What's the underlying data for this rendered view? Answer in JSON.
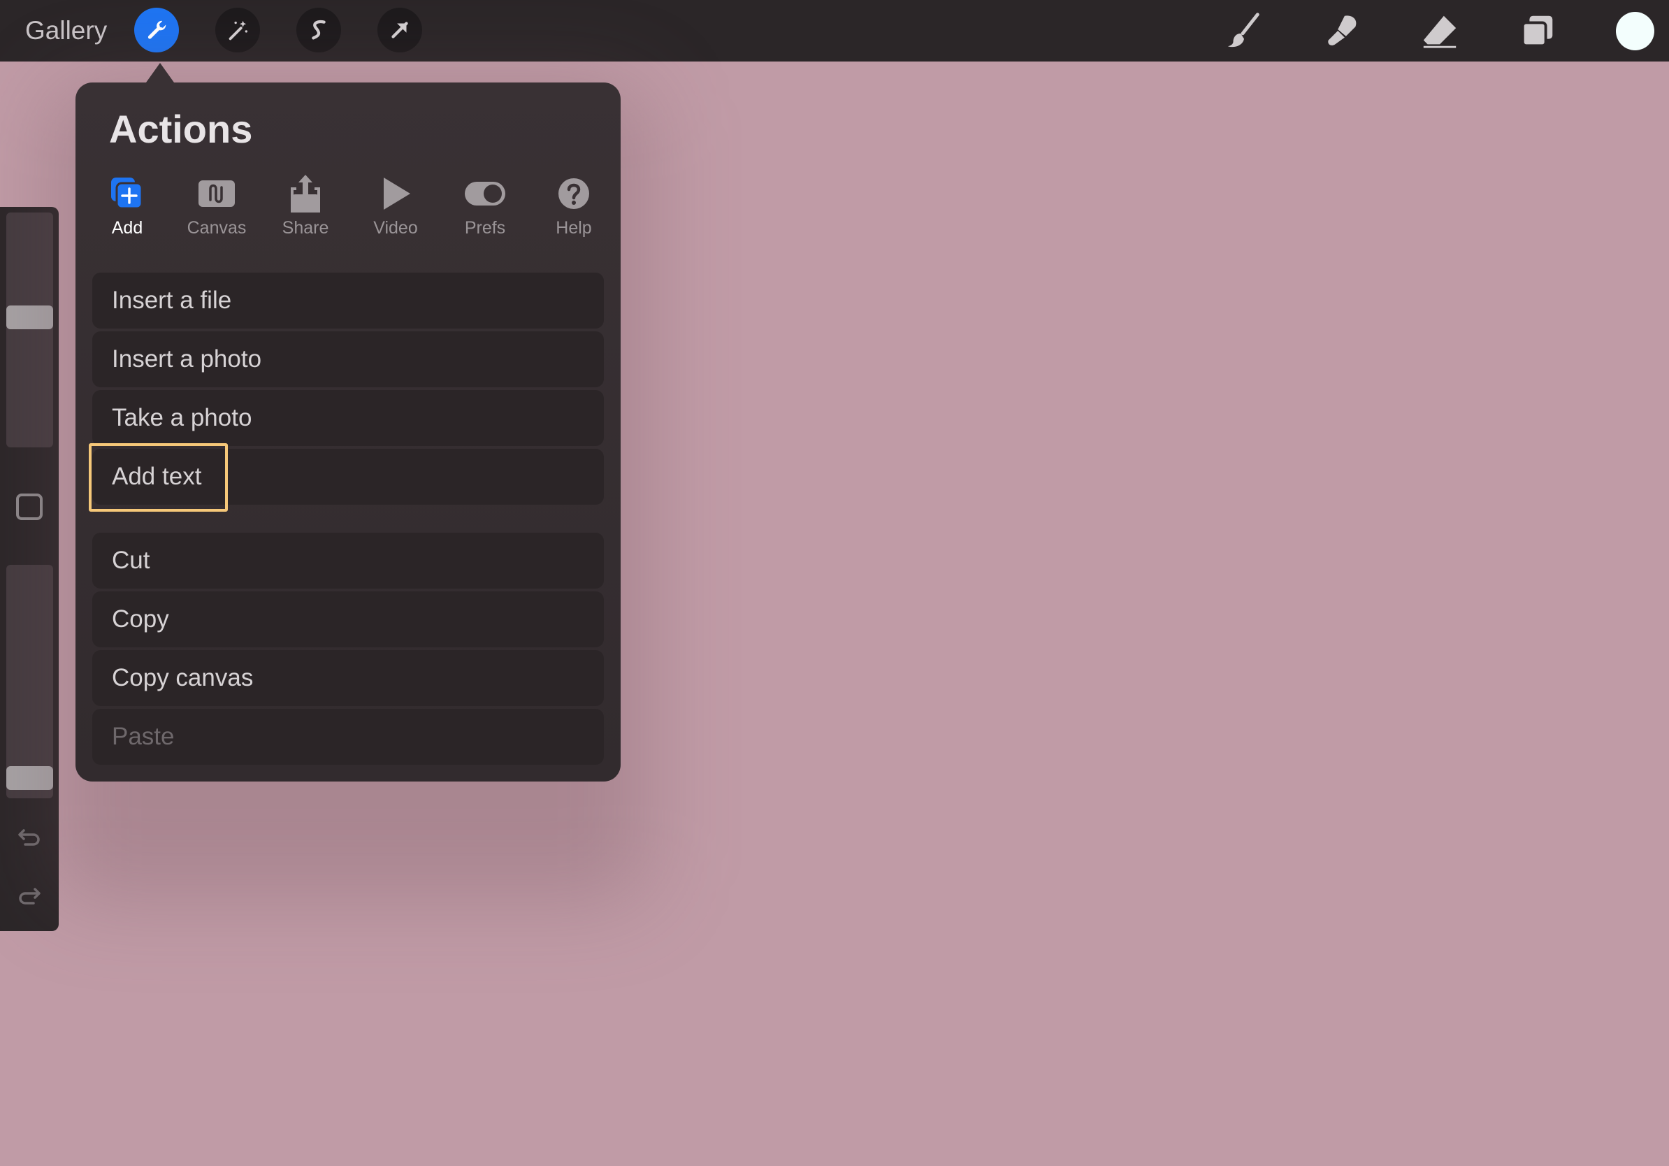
{
  "topbar": {
    "gallery_label": "Gallery",
    "tools_left": [
      "wrench-icon",
      "magic-wand-icon",
      "selection-s-icon",
      "transform-arrow-icon"
    ],
    "tools_right": [
      "brush-icon",
      "smudge-icon",
      "eraser-icon",
      "layers-icon"
    ],
    "current_color": "#f3fefd",
    "accent_color": "#1e74f2"
  },
  "panel": {
    "title": "Actions",
    "tabs": [
      {
        "label": "Add",
        "icon": "add-icon",
        "active": true
      },
      {
        "label": "Canvas",
        "icon": "canvas-icon",
        "active": false
      },
      {
        "label": "Share",
        "icon": "share-icon",
        "active": false
      },
      {
        "label": "Video",
        "icon": "video-play-icon",
        "active": false
      },
      {
        "label": "Prefs",
        "icon": "toggle-icon",
        "active": false
      },
      {
        "label": "Help",
        "icon": "help-icon",
        "active": false
      }
    ],
    "group1": [
      {
        "label": "Insert a file"
      },
      {
        "label": "Insert a photo"
      },
      {
        "label": "Take a photo"
      },
      {
        "label": "Add text"
      }
    ],
    "group2": [
      {
        "label": "Cut"
      },
      {
        "label": "Copy"
      },
      {
        "label": "Copy canvas"
      },
      {
        "label": "Paste",
        "disabled": true
      }
    ],
    "highlighted_item": "Add text"
  },
  "sidebar": {
    "brush_size_fraction": 0.56,
    "opacity_fraction": 0.04
  }
}
